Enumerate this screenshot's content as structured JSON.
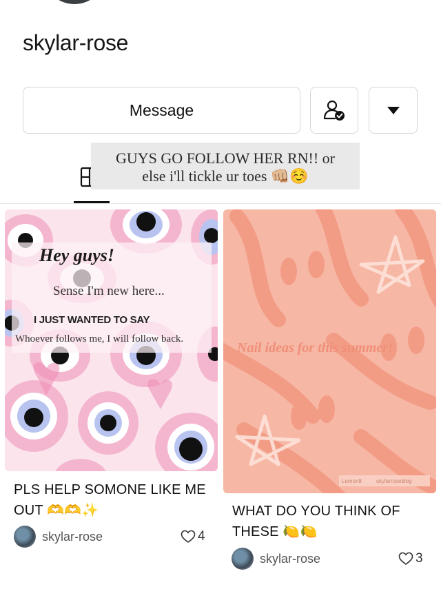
{
  "profile": {
    "username": "skylar-rose"
  },
  "actions": {
    "message_label": "Message"
  },
  "sticker": {
    "line1": "GUYS GO FOLLOW HER RN!! or",
    "line2": "else i'll tickle ur toes 👊🏼☺️"
  },
  "posts": [
    {
      "image_text": {
        "heading": "Hey guys!",
        "line1": "Sense I'm new here...",
        "line2": "I JUST WANTED TO SAY",
        "line3": "Whoever follows me, I will follow back."
      },
      "title": "PLS HELP SOMONE LIKE ME OUT 🫶🫶✨",
      "author": "skylar-rose",
      "likes": "4"
    },
    {
      "image_text": {
        "caption": "Nail ideas for this summer!",
        "watermark_brand": "Lemon8",
        "watermark_user": "skylarroseblog"
      },
      "title": "WHAT DO YOU THINK OF THESE 🍋🍋",
      "author": "skylar-rose",
      "likes": "3"
    }
  ],
  "colors": {
    "accent": "#111111",
    "card1_bg": "#fbe4ec",
    "card2_bg": "#f7b7a5"
  }
}
